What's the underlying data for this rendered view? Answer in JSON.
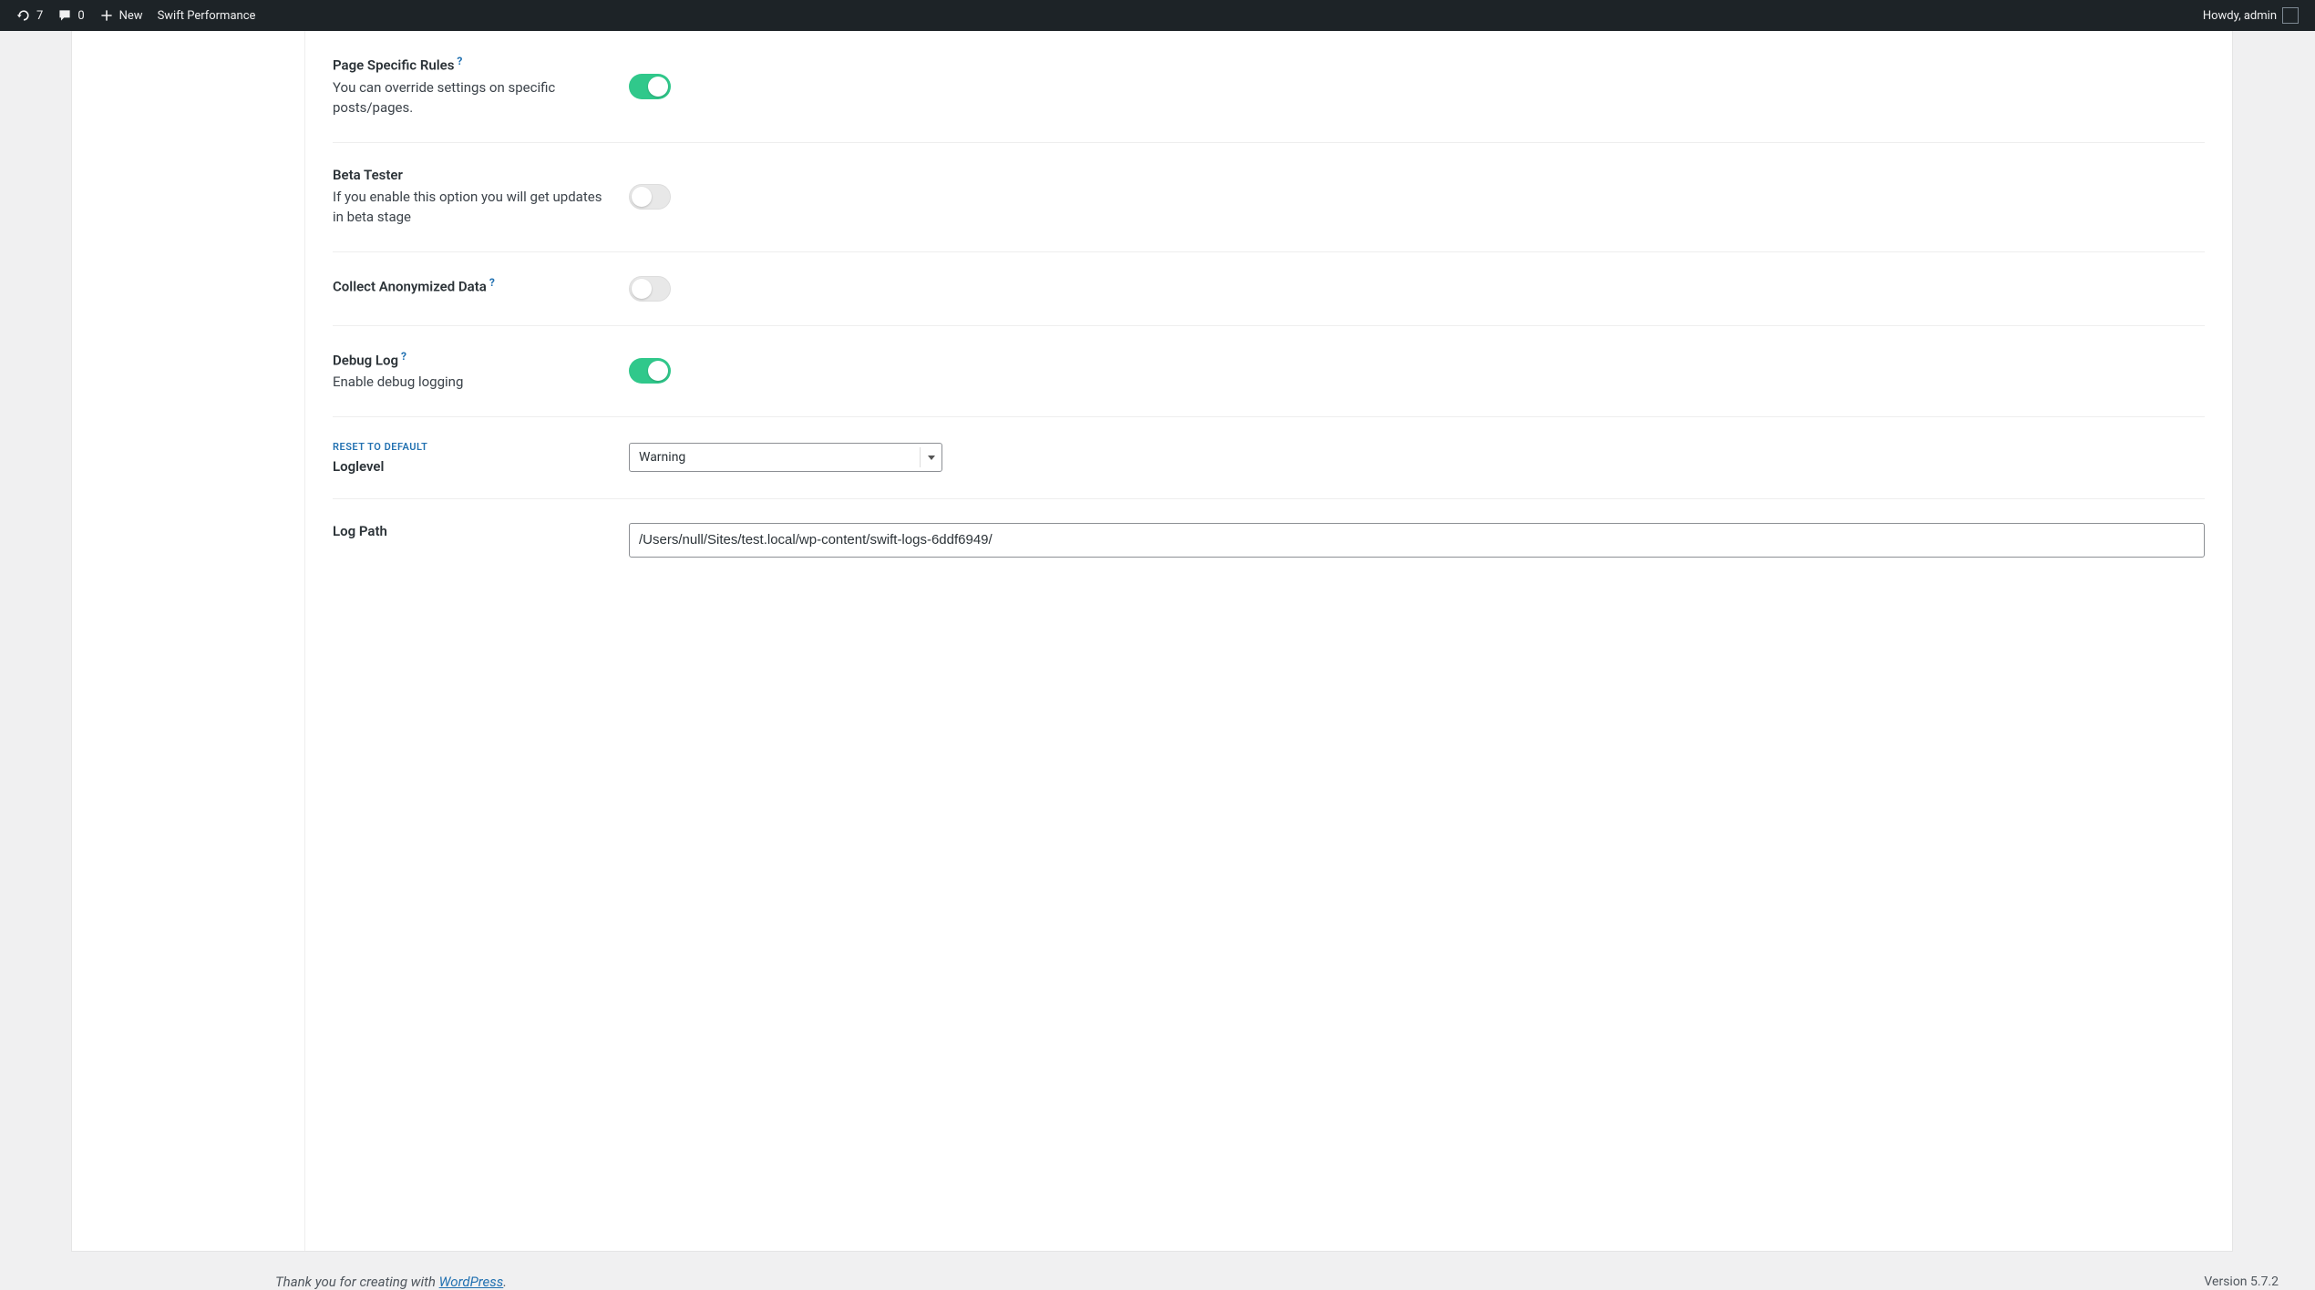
{
  "admin_bar": {
    "updates_count": "7",
    "comments_count": "0",
    "new_label": "New",
    "plugin_label": "Swift Performance",
    "howdy": "Howdy, admin"
  },
  "settings": {
    "page_specific": {
      "title": "Page Specific Rules",
      "desc": "You can override settings on specific posts/pages.",
      "value": true
    },
    "beta_tester": {
      "title": "Beta Tester",
      "desc": "If you enable this option you will get updates in beta stage",
      "value": false
    },
    "collect_anon": {
      "title": "Collect Anonymized Data",
      "value": false
    },
    "debug_log": {
      "title": "Debug Log",
      "desc": "Enable debug logging",
      "value": true
    },
    "loglevel": {
      "reset_label": "RESET TO DEFAULT",
      "title": "Loglevel",
      "selected": "Warning"
    },
    "log_path": {
      "title": "Log Path",
      "value": "/Users/null/Sites/test.local/wp-content/swift-logs-6ddf6949/"
    }
  },
  "footer": {
    "thank_you_prefix": "Thank you for creating with ",
    "wp_link": "WordPress",
    "thank_you_suffix": ".",
    "version": "Version 5.7.2"
  }
}
